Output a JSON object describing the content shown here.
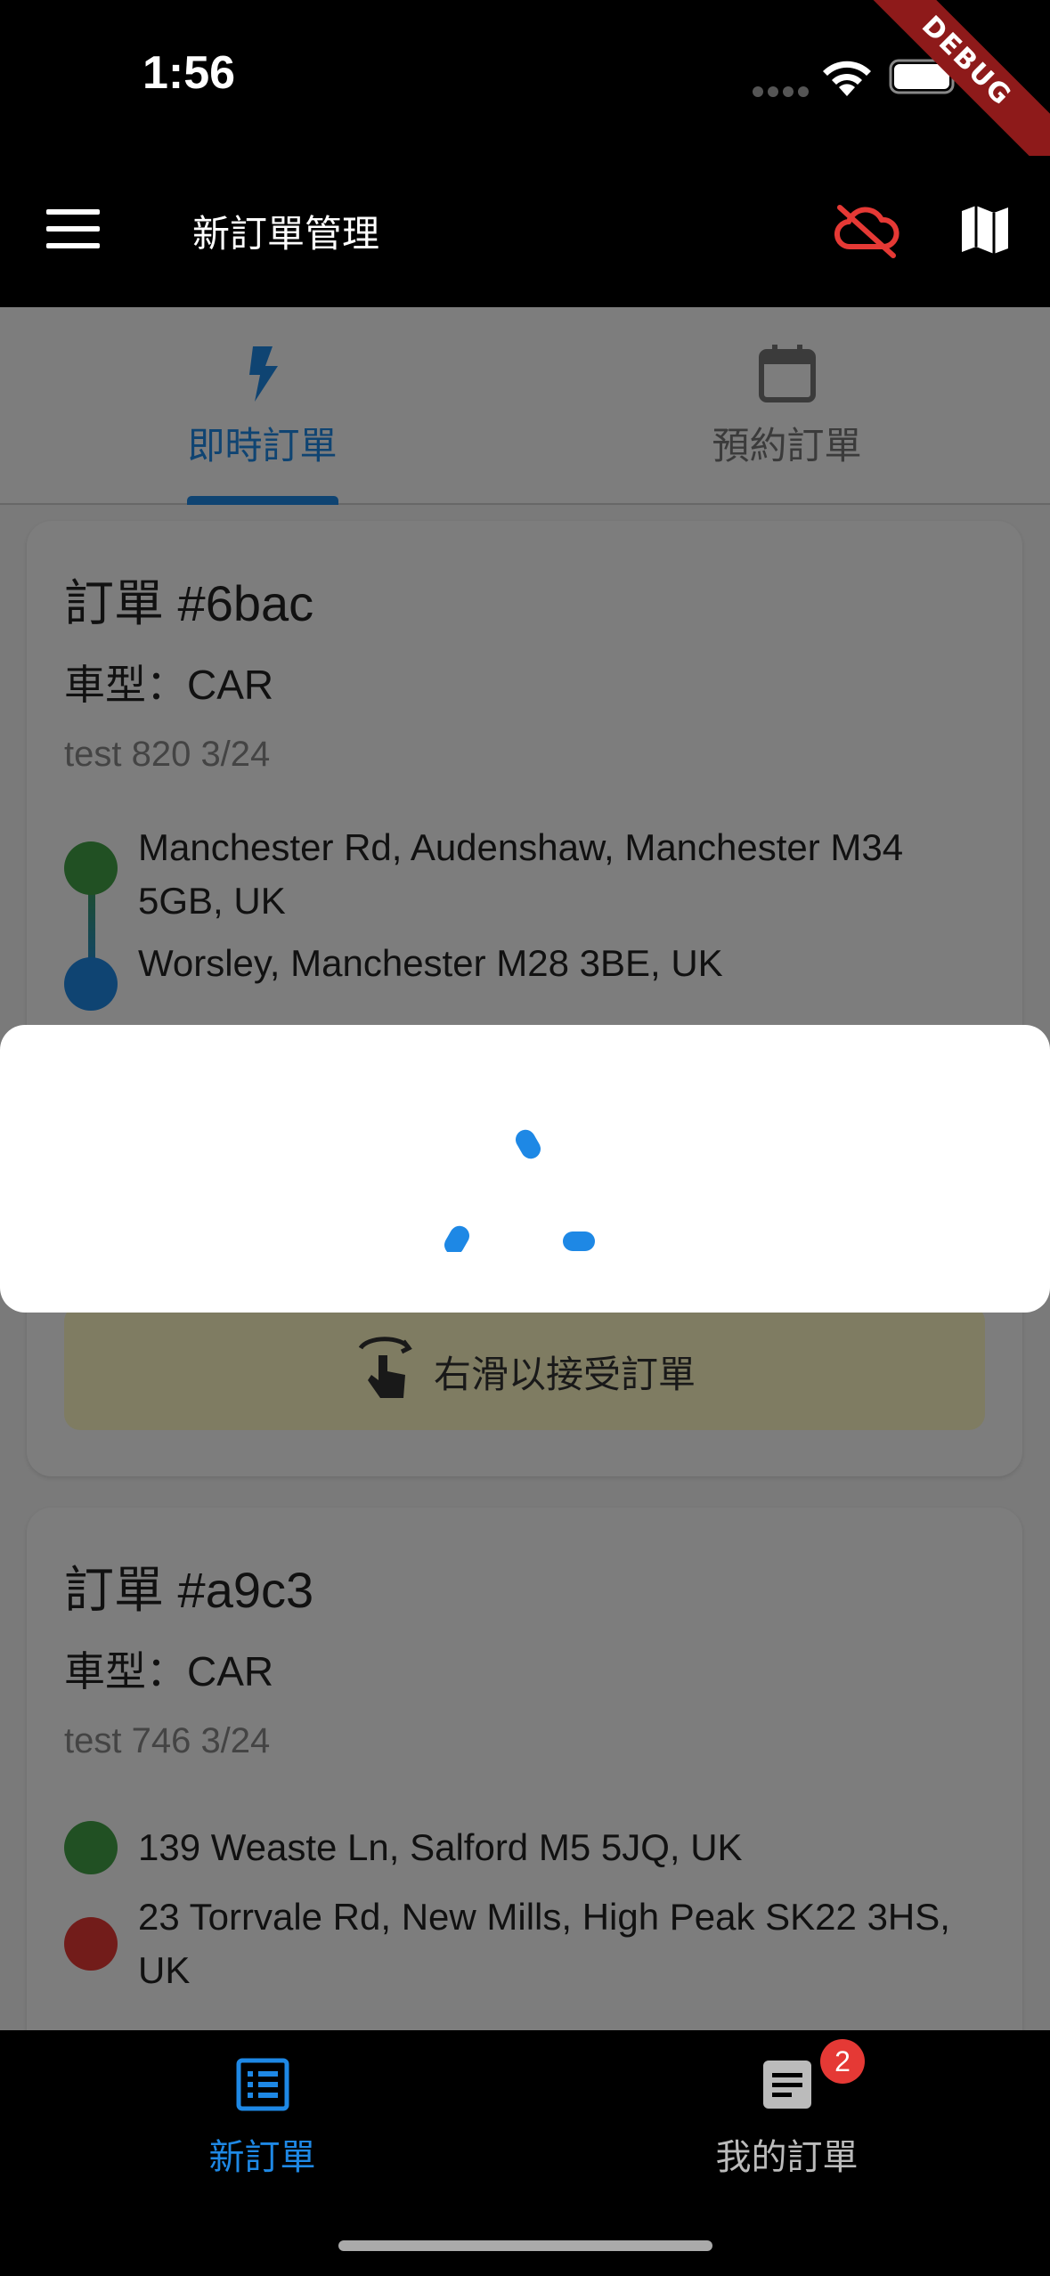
{
  "status_bar": {
    "time": "1:56",
    "debug_label": "DEBUG"
  },
  "app_bar": {
    "title": "新訂單管理"
  },
  "tabs": [
    {
      "label": "即時訂單",
      "icon": "bolt-icon",
      "active": true
    },
    {
      "label": "預約訂單",
      "icon": "calendar-icon",
      "active": false
    }
  ],
  "orders": [
    {
      "title": "訂單 #6bac",
      "vehicle": "車型：CAR",
      "note": "test 820 3/24",
      "pickup": "Manchester Rd, Audenshaw, Manchester M34 5GB, UK",
      "dropoff": "Worsley, Manchester M28 3BE, UK",
      "swipe_label": "右滑以接受訂單"
    },
    {
      "title": "訂單 #a9c3",
      "vehicle": "車型：CAR",
      "note": "test 746 3/24",
      "pickup": "139 Weaste Ln, Salford M5 5JQ, UK",
      "dropoff": "23 Torrvale Rd, New Mills, High Peak SK22 3HS, UK"
    }
  ],
  "bottom_nav": {
    "items": [
      {
        "label": "新訂單",
        "icon": "list-icon",
        "active": true
      },
      {
        "label": "我的訂單",
        "icon": "document-icon",
        "active": false,
        "badge": "2"
      }
    ]
  },
  "colors": {
    "accent": "#1e88e5",
    "offline": "#e53935",
    "pickup": "#43a047",
    "dropoff_blue": "#1e88e5",
    "dropoff_red": "#e53935",
    "swipe_bg": "#fff9c4"
  }
}
